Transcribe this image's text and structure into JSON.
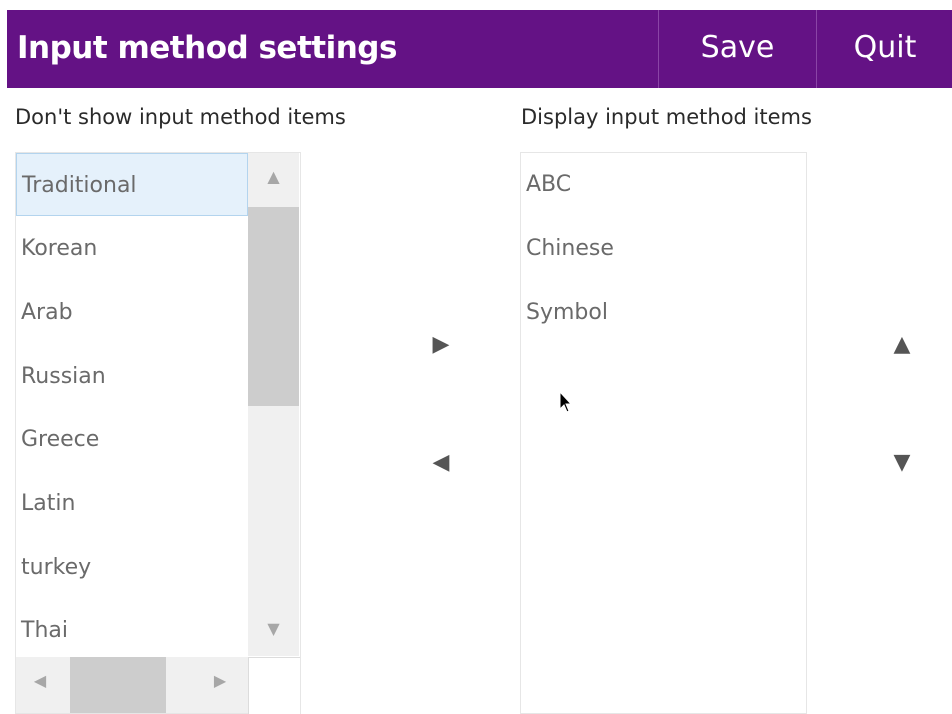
{
  "header": {
    "title": "Input method settings",
    "save_label": "Save",
    "quit_label": "Quit",
    "background": "#641285"
  },
  "left_panel": {
    "label": "Don't show input method items",
    "items": [
      "Traditional",
      "Korean",
      "Arab",
      "Russian",
      "Greece",
      "Latin",
      "turkey",
      "Thai"
    ],
    "selected": "Traditional"
  },
  "right_panel": {
    "label": "Display input method items",
    "items": [
      "ABC",
      "Chinese",
      "Symbol"
    ]
  },
  "icons": {
    "move_right": "triangle-right-icon",
    "move_left": "triangle-left-icon",
    "move_up": "triangle-up-icon",
    "move_down": "triangle-down-icon"
  }
}
